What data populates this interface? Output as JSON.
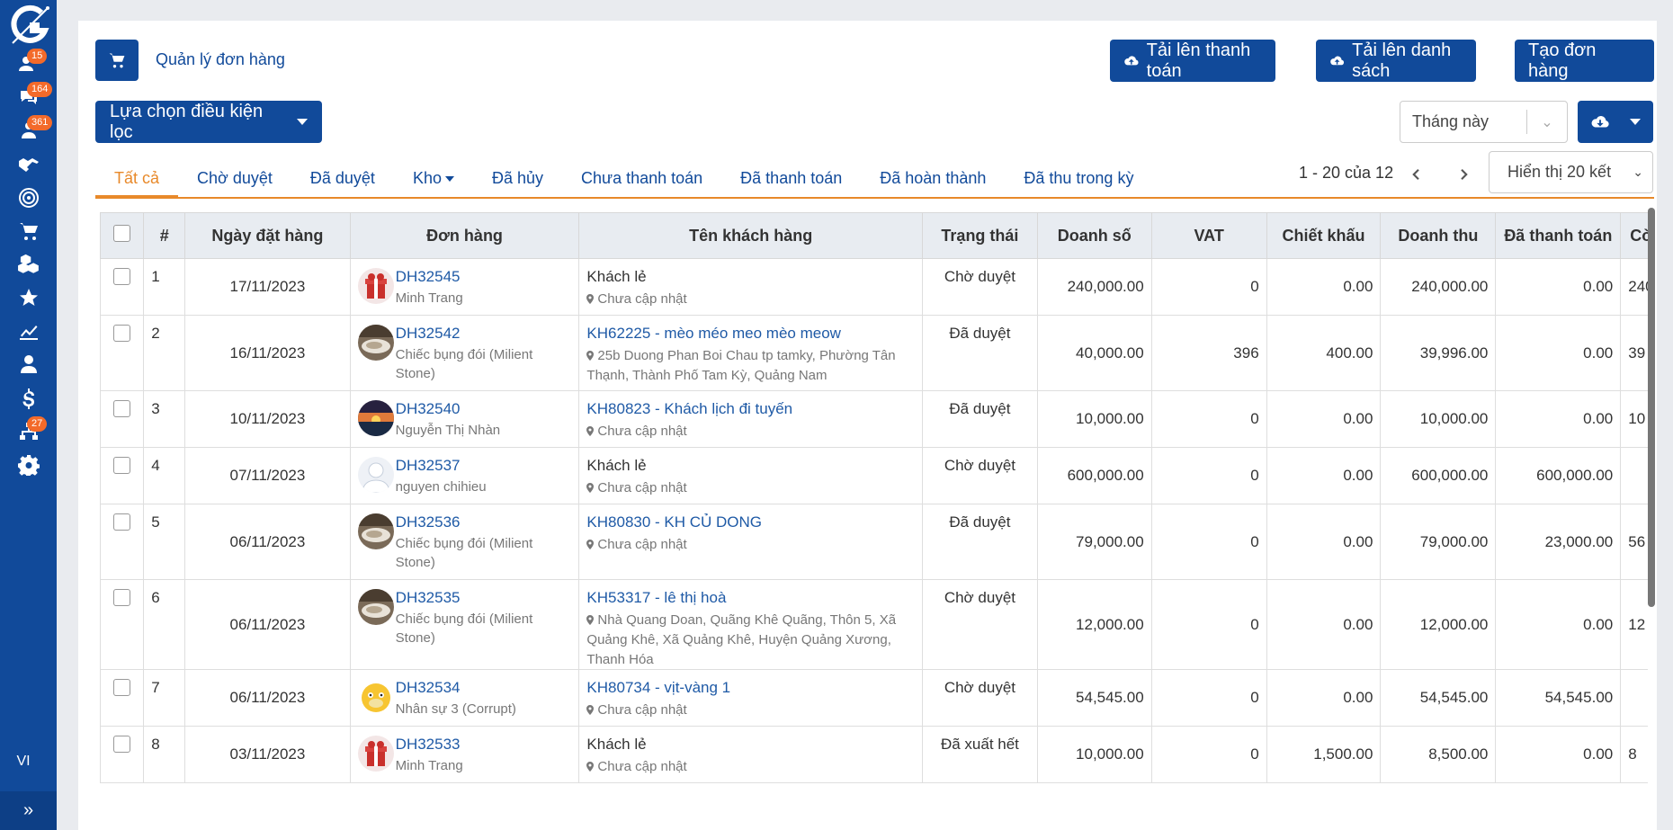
{
  "sidebar": {
    "items": [
      {
        "icon": "user-group-icon",
        "badge": "15"
      },
      {
        "icon": "chat-icon",
        "badge": "164"
      },
      {
        "icon": "users-icon",
        "badge": "361"
      },
      {
        "icon": "handshake-icon",
        "badge": ""
      },
      {
        "icon": "target-icon",
        "badge": ""
      },
      {
        "icon": "cart-icon",
        "badge": ""
      },
      {
        "icon": "boxes-icon",
        "badge": ""
      },
      {
        "icon": "star-icon",
        "badge": ""
      },
      {
        "icon": "chart-line-icon",
        "badge": ""
      },
      {
        "icon": "person-icon",
        "badge": ""
      },
      {
        "icon": "dollar-icon",
        "badge": ""
      },
      {
        "icon": "sitemap-icon",
        "badge": "27"
      },
      {
        "icon": "gear-icon",
        "badge": ""
      }
    ],
    "language": "VI",
    "expand_icon": "»"
  },
  "header": {
    "title": "Quản lý đơn hàng",
    "upload_payment": "Tải lên thanh toán",
    "upload_list": "Tải lên danh sách",
    "create_order": "Tạo đơn hàng",
    "filter_button": "Lựa chọn điều kiện lọc",
    "period": "Tháng này"
  },
  "tabs": [
    {
      "label": "Tất cả",
      "active": true
    },
    {
      "label": "Chờ duyệt"
    },
    {
      "label": "Đã duyệt"
    },
    {
      "label": "Kho"
    },
    {
      "label": "Đã hủy"
    },
    {
      "label": "Chưa thanh toán"
    },
    {
      "label": "Đã thanh toán"
    },
    {
      "label": "Đã hoàn thành"
    },
    {
      "label": "Đã thu trong kỳ"
    }
  ],
  "pagination": {
    "range": "1 - 20 của 12",
    "page_size": "Hiển thị 20 kết"
  },
  "table": {
    "columns": [
      "#",
      "Ngày đặt hàng",
      "Đơn hàng",
      "Tên khách hàng",
      "Trạng thái",
      "Doanh số",
      "VAT",
      "Chiết khấu",
      "Doanh thu",
      "Đã thanh toán",
      "Cò"
    ],
    "rows": [
      {
        "no": "1",
        "date": "17/11/2023",
        "order": "DH32545",
        "order_sub": "Minh Trang",
        "avatar": "gift",
        "customer": "Khách lẻ",
        "customer_link": false,
        "address": "Chưa cập nhật",
        "status": "Chờ duyệt",
        "sales": "240,000.00",
        "vat": "0",
        "discount": "0.00",
        "revenue": "240,000.00",
        "paid": "0.00",
        "remain": "240"
      },
      {
        "no": "2",
        "date": "16/11/2023",
        "order": "DH32542",
        "order_sub": "Chiếc bụng đói (Milient Stone)",
        "avatar": "photo",
        "customer": "KH62225 - mèo méo meo mèo meow",
        "customer_link": true,
        "address": "25b Duong Phan Boi Chau tp tamky, Phường Tân Thạnh, Thành Phố Tam Kỳ, Quảng Nam",
        "status": "Đã duyệt",
        "sales": "40,000.00",
        "vat": "396",
        "discount": "400.00",
        "revenue": "39,996.00",
        "paid": "0.00",
        "remain": "39"
      },
      {
        "no": "3",
        "date": "10/11/2023",
        "order": "DH32540",
        "order_sub": "Nguyễn Thị Nhàn",
        "avatar": "sunset",
        "customer": "KH80823 - Khách lịch đi tuyến",
        "customer_link": true,
        "address": "Chưa cập nhật",
        "status": "Đã duyệt",
        "sales": "10,000.00",
        "vat": "0",
        "discount": "0.00",
        "revenue": "10,000.00",
        "paid": "0.00",
        "remain": "10"
      },
      {
        "no": "4",
        "date": "07/11/2023",
        "order": "DH32537",
        "order_sub": "nguyen chihieu",
        "avatar": "default",
        "customer": "Khách lẻ",
        "customer_link": false,
        "address": "Chưa cập nhật",
        "status": "Chờ duyệt",
        "sales": "600,000.00",
        "vat": "0",
        "discount": "0.00",
        "revenue": "600,000.00",
        "paid": "600,000.00",
        "remain": ""
      },
      {
        "no": "5",
        "date": "06/11/2023",
        "order": "DH32536",
        "order_sub": "Chiếc bụng đói (Milient Stone)",
        "avatar": "photo",
        "customer": "KH80830 - KH CỦ DONG",
        "customer_link": true,
        "address": "Chưa cập nhật",
        "status": "Đã duyệt",
        "sales": "79,000.00",
        "vat": "0",
        "discount": "0.00",
        "revenue": "79,000.00",
        "paid": "23,000.00",
        "remain": "56"
      },
      {
        "no": "6",
        "date": "06/11/2023",
        "order": "DH32535",
        "order_sub": "Chiếc bụng đói (Milient Stone)",
        "avatar": "photo",
        "customer": "KH53317 - lê thị hoà",
        "customer_link": true,
        "address": "Nhà Quang Doan, Quãng Khê Quãng, Thôn 5, Xã Quảng Khê, Xã Quảng Khê, Huyện Quảng Xương, Thanh Hóa",
        "status": "Chờ duyệt",
        "sales": "12,000.00",
        "vat": "0",
        "discount": "0.00",
        "revenue": "12,000.00",
        "paid": "0.00",
        "remain": "12"
      },
      {
        "no": "7",
        "date": "06/11/2023",
        "order": "DH32534",
        "order_sub": "Nhân sự 3 (Corrupt)",
        "avatar": "duck",
        "customer": "KH80734 - vịt-vàng 1",
        "customer_link": true,
        "address": "Chưa cập nhật",
        "status": "Chờ duyệt",
        "sales": "54,545.00",
        "vat": "0",
        "discount": "0.00",
        "revenue": "54,545.00",
        "paid": "54,545.00",
        "remain": ""
      },
      {
        "no": "8",
        "date": "03/11/2023",
        "order": "DH32533",
        "order_sub": "Minh Trang",
        "avatar": "gift",
        "customer": "Khách lẻ",
        "customer_link": false,
        "address": "Chưa cập nhật",
        "status": "Đã xuất hết",
        "sales": "10,000.00",
        "vat": "0",
        "discount": "1,500.00",
        "revenue": "8,500.00",
        "paid": "0.00",
        "remain": "8"
      }
    ]
  },
  "colors": {
    "brand": "#114a9a",
    "accent": "#e8892a",
    "badge": "#f36a2a"
  }
}
